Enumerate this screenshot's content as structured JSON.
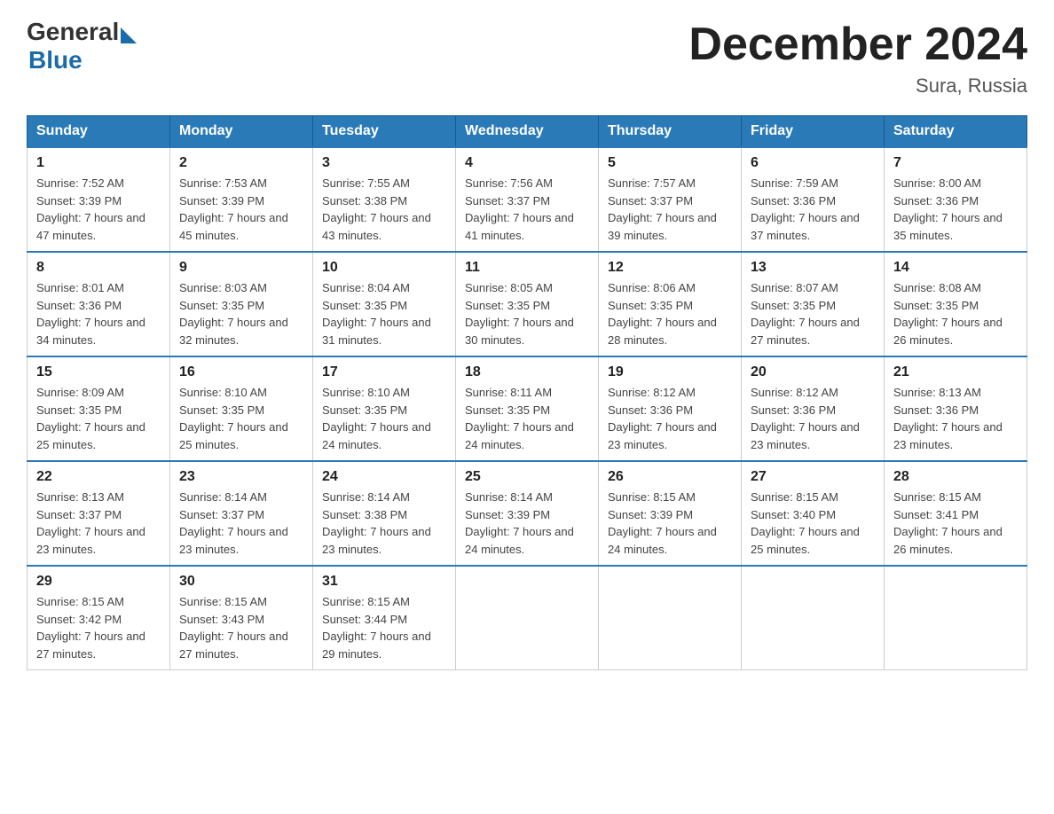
{
  "header": {
    "logo": {
      "general": "General",
      "blue": "Blue"
    },
    "title": "December 2024",
    "location": "Sura, Russia"
  },
  "calendar": {
    "days_of_week": [
      "Sunday",
      "Monday",
      "Tuesday",
      "Wednesday",
      "Thursday",
      "Friday",
      "Saturday"
    ],
    "weeks": [
      [
        {
          "day": "1",
          "sunrise": "7:52 AM",
          "sunset": "3:39 PM",
          "daylight": "7 hours and 47 minutes."
        },
        {
          "day": "2",
          "sunrise": "7:53 AM",
          "sunset": "3:39 PM",
          "daylight": "7 hours and 45 minutes."
        },
        {
          "day": "3",
          "sunrise": "7:55 AM",
          "sunset": "3:38 PM",
          "daylight": "7 hours and 43 minutes."
        },
        {
          "day": "4",
          "sunrise": "7:56 AM",
          "sunset": "3:37 PM",
          "daylight": "7 hours and 41 minutes."
        },
        {
          "day": "5",
          "sunrise": "7:57 AM",
          "sunset": "3:37 PM",
          "daylight": "7 hours and 39 minutes."
        },
        {
          "day": "6",
          "sunrise": "7:59 AM",
          "sunset": "3:36 PM",
          "daylight": "7 hours and 37 minutes."
        },
        {
          "day": "7",
          "sunrise": "8:00 AM",
          "sunset": "3:36 PM",
          "daylight": "7 hours and 35 minutes."
        }
      ],
      [
        {
          "day": "8",
          "sunrise": "8:01 AM",
          "sunset": "3:36 PM",
          "daylight": "7 hours and 34 minutes."
        },
        {
          "day": "9",
          "sunrise": "8:03 AM",
          "sunset": "3:35 PM",
          "daylight": "7 hours and 32 minutes."
        },
        {
          "day": "10",
          "sunrise": "8:04 AM",
          "sunset": "3:35 PM",
          "daylight": "7 hours and 31 minutes."
        },
        {
          "day": "11",
          "sunrise": "8:05 AM",
          "sunset": "3:35 PM",
          "daylight": "7 hours and 30 minutes."
        },
        {
          "day": "12",
          "sunrise": "8:06 AM",
          "sunset": "3:35 PM",
          "daylight": "7 hours and 28 minutes."
        },
        {
          "day": "13",
          "sunrise": "8:07 AM",
          "sunset": "3:35 PM",
          "daylight": "7 hours and 27 minutes."
        },
        {
          "day": "14",
          "sunrise": "8:08 AM",
          "sunset": "3:35 PM",
          "daylight": "7 hours and 26 minutes."
        }
      ],
      [
        {
          "day": "15",
          "sunrise": "8:09 AM",
          "sunset": "3:35 PM",
          "daylight": "7 hours and 25 minutes."
        },
        {
          "day": "16",
          "sunrise": "8:10 AM",
          "sunset": "3:35 PM",
          "daylight": "7 hours and 25 minutes."
        },
        {
          "day": "17",
          "sunrise": "8:10 AM",
          "sunset": "3:35 PM",
          "daylight": "7 hours and 24 minutes."
        },
        {
          "day": "18",
          "sunrise": "8:11 AM",
          "sunset": "3:35 PM",
          "daylight": "7 hours and 24 minutes."
        },
        {
          "day": "19",
          "sunrise": "8:12 AM",
          "sunset": "3:36 PM",
          "daylight": "7 hours and 23 minutes."
        },
        {
          "day": "20",
          "sunrise": "8:12 AM",
          "sunset": "3:36 PM",
          "daylight": "7 hours and 23 minutes."
        },
        {
          "day": "21",
          "sunrise": "8:13 AM",
          "sunset": "3:36 PM",
          "daylight": "7 hours and 23 minutes."
        }
      ],
      [
        {
          "day": "22",
          "sunrise": "8:13 AM",
          "sunset": "3:37 PM",
          "daylight": "7 hours and 23 minutes."
        },
        {
          "day": "23",
          "sunrise": "8:14 AM",
          "sunset": "3:37 PM",
          "daylight": "7 hours and 23 minutes."
        },
        {
          "day": "24",
          "sunrise": "8:14 AM",
          "sunset": "3:38 PM",
          "daylight": "7 hours and 23 minutes."
        },
        {
          "day": "25",
          "sunrise": "8:14 AM",
          "sunset": "3:39 PM",
          "daylight": "7 hours and 24 minutes."
        },
        {
          "day": "26",
          "sunrise": "8:15 AM",
          "sunset": "3:39 PM",
          "daylight": "7 hours and 24 minutes."
        },
        {
          "day": "27",
          "sunrise": "8:15 AM",
          "sunset": "3:40 PM",
          "daylight": "7 hours and 25 minutes."
        },
        {
          "day": "28",
          "sunrise": "8:15 AM",
          "sunset": "3:41 PM",
          "daylight": "7 hours and 26 minutes."
        }
      ],
      [
        {
          "day": "29",
          "sunrise": "8:15 AM",
          "sunset": "3:42 PM",
          "daylight": "7 hours and 27 minutes."
        },
        {
          "day": "30",
          "sunrise": "8:15 AM",
          "sunset": "3:43 PM",
          "daylight": "7 hours and 27 minutes."
        },
        {
          "day": "31",
          "sunrise": "8:15 AM",
          "sunset": "3:44 PM",
          "daylight": "7 hours and 29 minutes."
        },
        null,
        null,
        null,
        null
      ]
    ]
  }
}
